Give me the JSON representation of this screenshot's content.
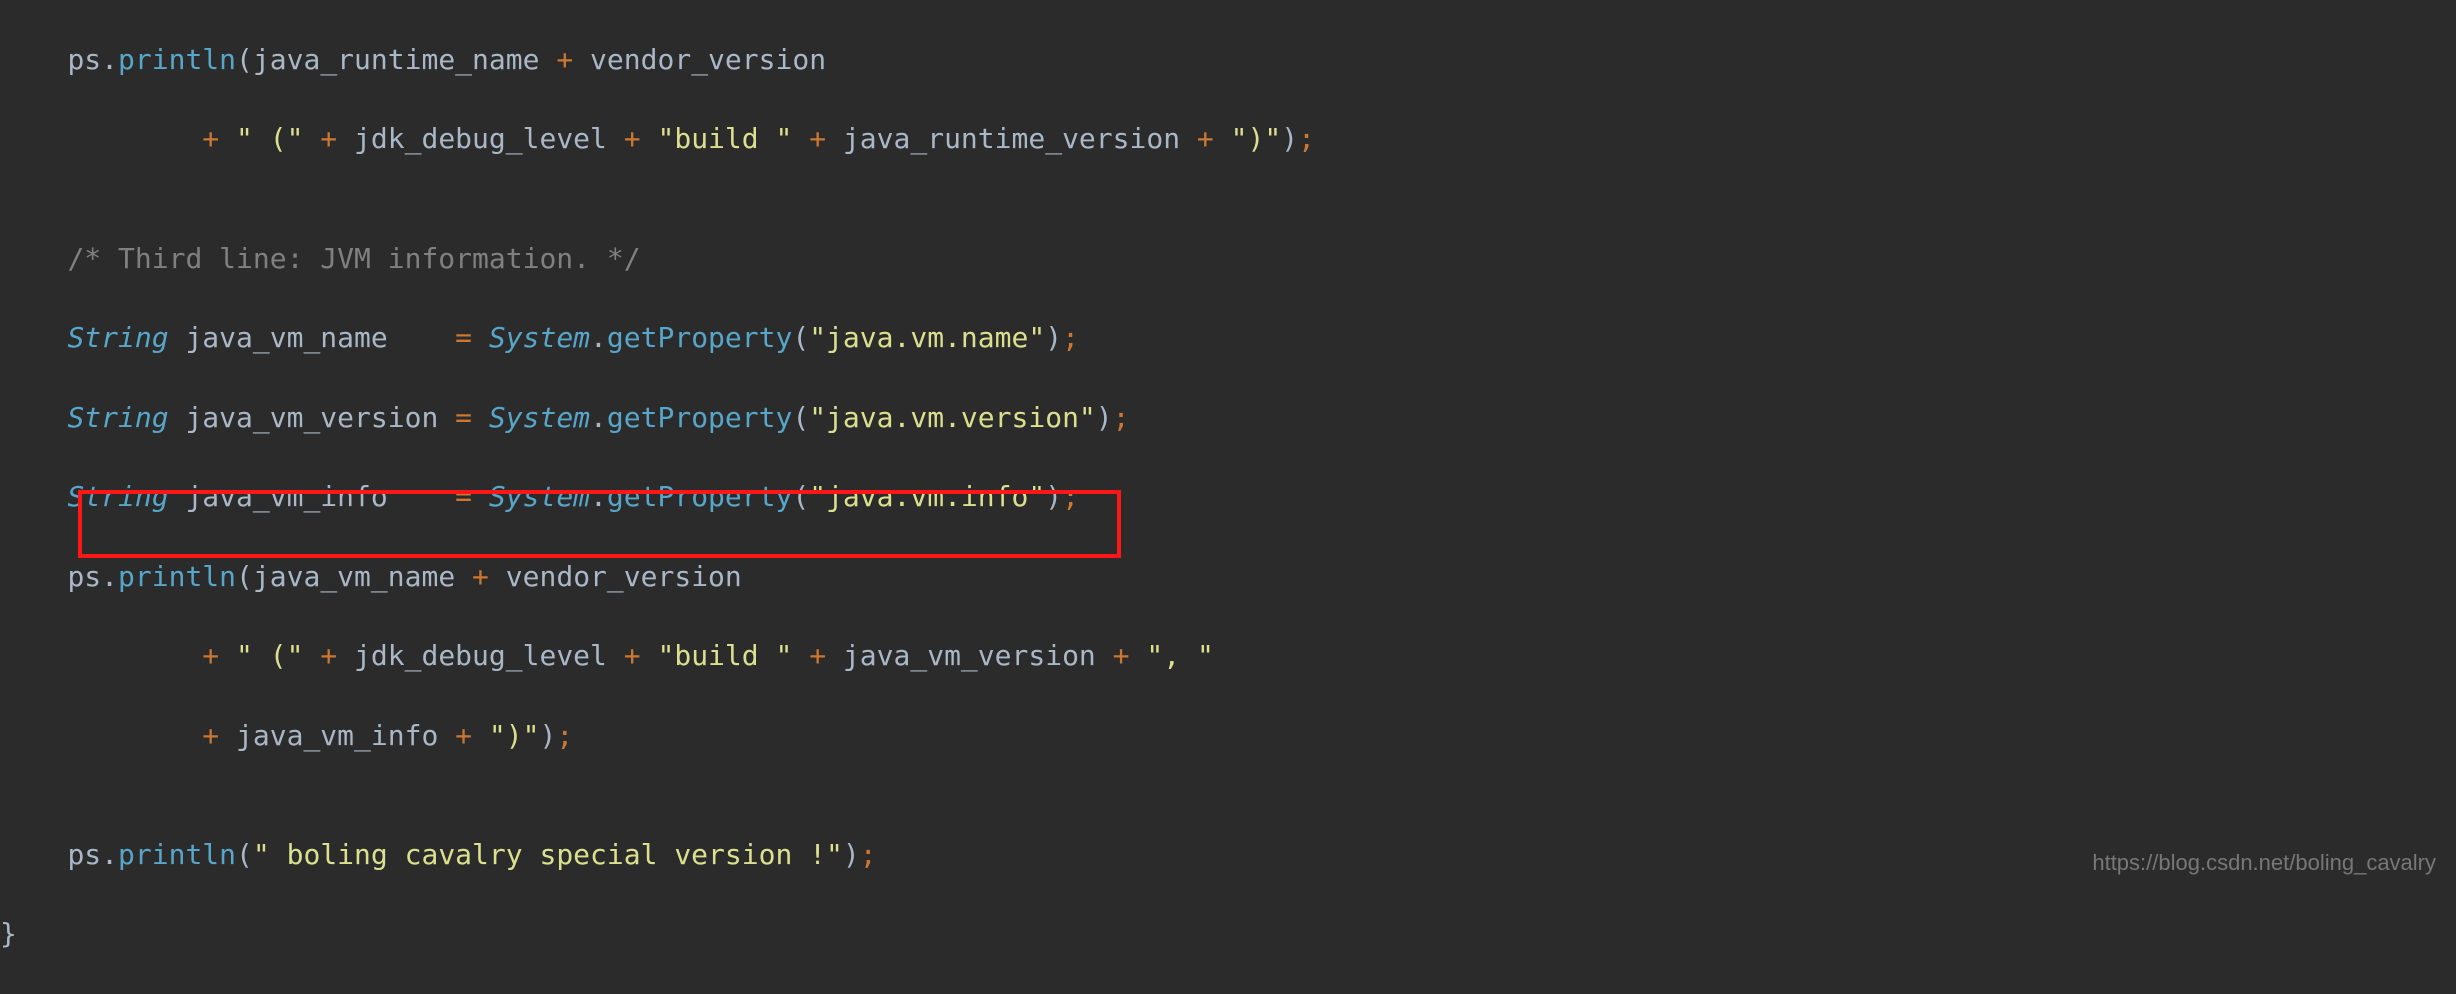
{
  "code": {
    "l1": {
      "indent": "    ",
      "obj": "ps",
      "dot": ".",
      "method": "println",
      "lp": "(",
      "a1": "java_runtime_name",
      "plus1": " + ",
      "a2": "vendor_version"
    },
    "l2": {
      "indent": "            ",
      "plus1": "+ ",
      "s1": "\" (\"",
      "plus2": " + ",
      "a1": "jdk_debug_level",
      "plus3": " + ",
      "s2": "\"build \"",
      "plus4": " + ",
      "a2": "java_runtime_version",
      "plus5": " + ",
      "s3": "\")\"",
      "rp": ")",
      "semi": ";"
    },
    "l3": {
      "blank": ""
    },
    "l4": {
      "indent": "    ",
      "comment": "/* Third line: JVM information. */"
    },
    "l5": {
      "indent": "    ",
      "type": "String",
      "var": " java_vm_name    ",
      "eq": "= ",
      "cls": "System",
      "dot": ".",
      "method": "getProperty",
      "lp": "(",
      "s": "\"java.vm.name\"",
      "rp": ")",
      "semi": ";"
    },
    "l6": {
      "indent": "    ",
      "type": "String",
      "var": " java_vm_version ",
      "eq": "= ",
      "cls": "System",
      "dot": ".",
      "method": "getProperty",
      "lp": "(",
      "s": "\"java.vm.version\"",
      "rp": ")",
      "semi": ";"
    },
    "l7": {
      "indent": "    ",
      "type": "String",
      "var": " java_vm_info    ",
      "eq": "= ",
      "cls": "System",
      "dot": ".",
      "method": "getProperty",
      "lp": "(",
      "s": "\"java.vm.info\"",
      "rp": ")",
      "semi": ";"
    },
    "l8": {
      "indent": "    ",
      "obj": "ps",
      "dot": ".",
      "method": "println",
      "lp": "(",
      "a1": "java_vm_name",
      "plus1": " + ",
      "a2": "vendor_version"
    },
    "l9": {
      "indent": "            ",
      "plus1": "+ ",
      "s1": "\" (\"",
      "plus2": " + ",
      "a1": "jdk_debug_level",
      "plus3": " + ",
      "s2": "\"build \"",
      "plus4": " + ",
      "a2": "java_vm_version",
      "plus5": " + ",
      "s3": "\", \""
    },
    "l10": {
      "indent": "            ",
      "plus1": "+ ",
      "a1": "java_vm_info",
      "plus2": " + ",
      "s1": "\")\"",
      "rp": ")",
      "semi": ";"
    },
    "l11": {
      "blank": ""
    },
    "l12": {
      "indent": "    ",
      "obj": "ps",
      "dot": ".",
      "method": "println",
      "lp": "(",
      "s": "\" boling cavalry special version !\"",
      "rp": ")",
      "semi": ";"
    },
    "l13": {
      "brace": "}"
    }
  },
  "watermark": "https://blog.csdn.net/boling_cavalry"
}
